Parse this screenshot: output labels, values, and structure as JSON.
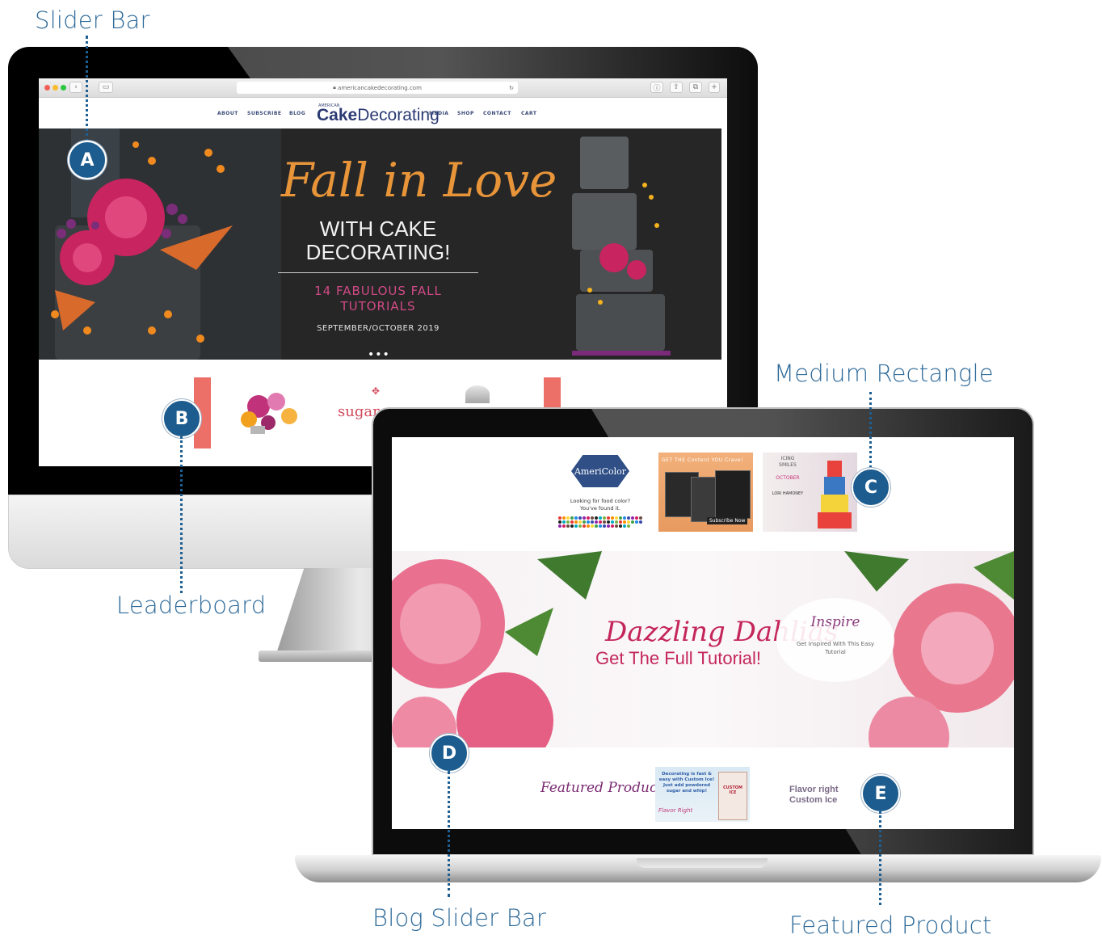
{
  "callouts": {
    "a": {
      "letter": "A",
      "label": "Slider Bar"
    },
    "b": {
      "letter": "B",
      "label": "Leaderboard"
    },
    "c": {
      "letter": "C",
      "label": "Medium Rectangle"
    },
    "d": {
      "letter": "D",
      "label": "Blog Slider Bar"
    },
    "e": {
      "letter": "E",
      "label": "Featured Product"
    }
  },
  "desktop_site": {
    "url": "americancakedecorating.com",
    "nav_left": [
      "ABOUT",
      "SUBSCRIBE",
      "BLOG"
    ],
    "nav_right": [
      "MEDIA",
      "SHOP",
      "CONTACT",
      "CART"
    ],
    "logo_small": "AMERICAN",
    "logo_bold": "Cake",
    "logo_rest": "Decorating",
    "hero": {
      "script_title": "Fall in Love",
      "subtitle_line1": "WITH CAKE",
      "subtitle_line2": "DECORATING!",
      "tutorials_line1": "14 FABULOUS FALL",
      "tutorials_line2": "TUTORIALS",
      "issue_date": "SEPTEMBER/OCTOBER 2019",
      "pager": "•••"
    },
    "leaderboard": {
      "sugar_text": "sugar"
    }
  },
  "laptop_site": {
    "americolor": {
      "brand": "AmeriColor",
      "tagline_line1": "Looking for food color?",
      "tagline_line2": "You've found it."
    },
    "subscribe_ad": {
      "head": "GET THE Content YOU Crave!",
      "button": "Subscribe Now"
    },
    "icing_ad": {
      "title_line1": "ICING",
      "title_line2": "SMILES",
      "month": "OCTOBER",
      "name": "LORI HAMONEY"
    },
    "blog_slider": {
      "script_title": "Dazzling Dahlias",
      "subtitle": "Get The Full Tutorial!",
      "inspire_title": "Inspire",
      "inspire_text": "Get Inspired With This Easy Tutorial"
    },
    "featured": {
      "script_label": "Featured Product",
      "ad_text": "Decorating is fast & easy with Custom Ice! Just add powdered sugar and whip!",
      "ad_caption": "Flavor Right",
      "bag_label": "CUSTOM ICE",
      "flavor_line1": "Flavor right",
      "flavor_line2": "Custom Ice"
    }
  },
  "colors": {
    "callout_text": "#2e6a99",
    "badge": "#1d5c8e",
    "hero_script": "#e8953a",
    "hero_pink": "#d04a86",
    "dahlia_pink": "#c4265b",
    "navy": "#2b3a73"
  }
}
